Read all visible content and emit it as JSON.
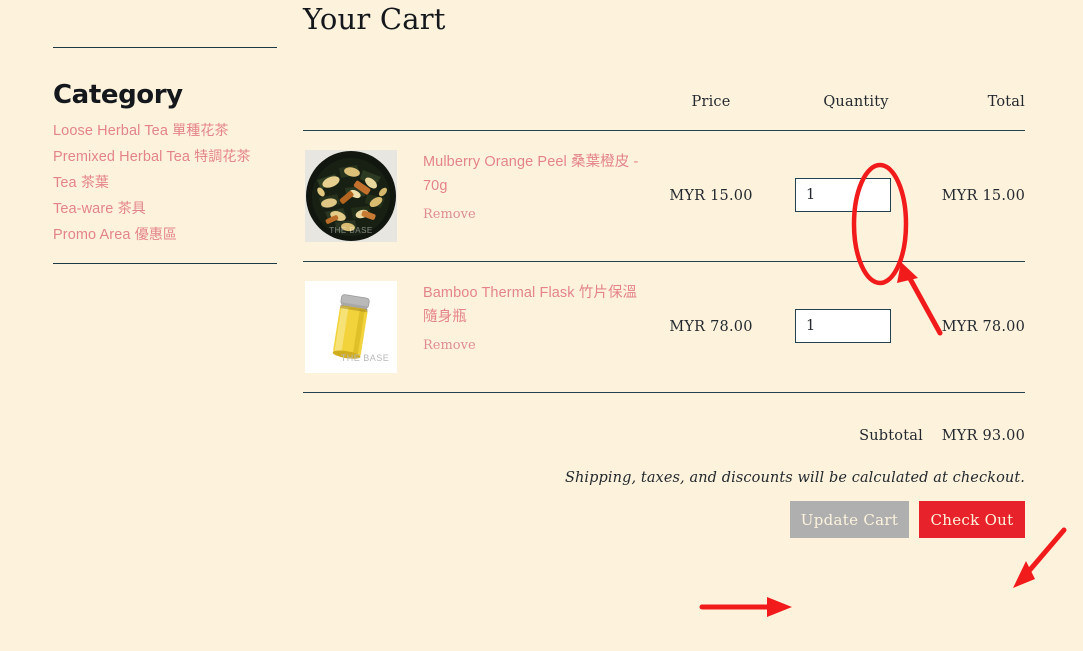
{
  "page": {
    "background_color": "#FDF3DD",
    "rule_color": "#23414f"
  },
  "sidebar": {
    "heading": "Category",
    "items": [
      {
        "en": "Loose Herbal Tea",
        "zh": "單種花茶"
      },
      {
        "en": "Premixed Herbal Tea",
        "zh": "特調花茶"
      },
      {
        "en": "Tea",
        "zh": "茶葉"
      },
      {
        "en": "Tea-ware",
        "zh": "茶具"
      },
      {
        "en": "Promo Area",
        "zh": "優惠區"
      }
    ],
    "link_color": "#E4848A"
  },
  "cart": {
    "title": "Your Cart",
    "columns": {
      "product": "",
      "price": "Price",
      "quantity": "Quantity",
      "total": "Total"
    },
    "items": [
      {
        "name": "Mulberry Orange Peel 桑葉橙皮 - 70g",
        "price": "MYR 15.00",
        "quantity": "1",
        "total": "MYR 15.00",
        "remove_label": "Remove",
        "image": "herbal-tea-bowl",
        "image_watermark": "THE BASE"
      },
      {
        "name": "Bamboo Thermal Flask 竹片保溫隨身瓶",
        "price": "MYR 78.00",
        "quantity": "1",
        "total": "MYR 78.00",
        "remove_label": "Remove",
        "image": "yellow-thermal-flask",
        "image_watermark": "THE BASE"
      }
    ],
    "subtotal_label": "Subtotal",
    "subtotal_value": "MYR 93.00",
    "shipping_note": "Shipping, taxes, and discounts will be calculated at checkout.",
    "update_button": "Update Cart",
    "checkout_button": "Check Out",
    "update_button_color": "#AFAFAF",
    "checkout_button_color": "#E8222A"
  },
  "annotations": {
    "color": "#F21B1B",
    "ellipse_target": "quantity-input-row-1",
    "arrow_targets": [
      "quantity-input-row-1",
      "update-cart-button",
      "checkout-button"
    ]
  }
}
